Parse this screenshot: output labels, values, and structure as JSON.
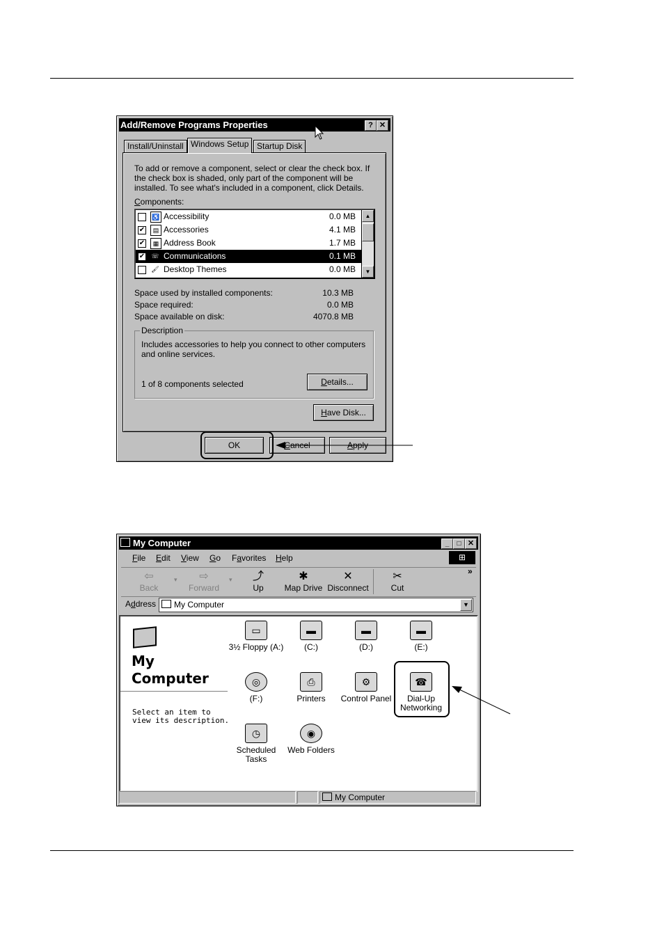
{
  "dialog": {
    "title": "Add/Remove Programs Properties",
    "title_help": "?",
    "title_close": "✕",
    "tabs": [
      {
        "label": "Install/Uninstall"
      },
      {
        "label": "Windows Setup"
      },
      {
        "label": "Startup Disk"
      }
    ],
    "instructions": [
      "To add or remove a component, select or clear the check box. If",
      "the check box is shaded, only part of the component will be",
      "installed. To see what's included in a component, click Details."
    ],
    "components_label_first": "C",
    "components_label_rest": "omponents:",
    "components": [
      {
        "name": "Accessibility",
        "size": "0.0 MB",
        "checked": false,
        "icon": "accessibility-icon"
      },
      {
        "name": "Accessories",
        "size": "4.1 MB",
        "checked": true,
        "icon": "accessories-icon"
      },
      {
        "name": "Address Book",
        "size": "1.7 MB",
        "checked": true,
        "icon": "address-book-icon"
      },
      {
        "name": "Communications",
        "size": "0.1 MB",
        "checked": true,
        "icon": "communications-icon",
        "selected": true
      },
      {
        "name": "Desktop Themes",
        "size": "0.0 MB",
        "checked": false,
        "icon": "desktop-themes-icon"
      }
    ],
    "space": [
      {
        "label": "Space used by installed components:",
        "value": "10.3 MB"
      },
      {
        "label": "Space required:",
        "value": "0.0 MB"
      },
      {
        "label": "Space available on disk:",
        "value": "4070.8 MB"
      }
    ],
    "description_label": "Description",
    "description_lines": [
      "Includes accessories to help you connect to other computers",
      "and online services."
    ],
    "selected_count": "1 of 8 components selected",
    "details_first": "D",
    "details_rest": "etails...",
    "havedisk_first": "H",
    "havedisk_rest": "ave Disk...",
    "ok_label": "OK",
    "cancel_first": "C",
    "cancel_rest": "ancel",
    "apply_first": "A",
    "apply_rest": "pply"
  },
  "explorer": {
    "title": "My Computer",
    "menu": [
      {
        "first": "F",
        "rest": "ile"
      },
      {
        "first": "E",
        "rest": "dit"
      },
      {
        "first": "V",
        "rest": "iew"
      },
      {
        "first": "G",
        "rest": "o"
      },
      {
        "first": "a",
        "pre": "F",
        "rest": "vorites"
      },
      {
        "first": "H",
        "rest": "elp"
      }
    ],
    "toolbar": [
      {
        "label": "Back",
        "icon": "back-arrow-icon",
        "glyph": "⇦",
        "disabled": true
      },
      {
        "label": "Forward",
        "icon": "forward-arrow-icon",
        "glyph": "⇨",
        "disabled": true
      },
      {
        "label": "Up",
        "icon": "up-folder-icon",
        "glyph": "⤴",
        "disabled": false
      },
      {
        "label": "Map Drive",
        "icon": "map-drive-icon",
        "glyph": "✱",
        "disabled": false
      },
      {
        "label": "Disconnect",
        "icon": "disconnect-icon",
        "glyph": "✕",
        "disabled": false
      },
      {
        "label": "Cut",
        "icon": "scissors-icon",
        "glyph": "✂",
        "disabled": false
      }
    ],
    "chevron": "»",
    "address_label_pre": "A",
    "address_label_first": "d",
    "address_label_rest": "dress",
    "address_value": "My Computer",
    "side_title_1": "My",
    "side_title_2": "Computer",
    "side_text_1": "Select an item to",
    "side_text_2": "view its description.",
    "items": [
      {
        "label": "3½ Floppy (A:)",
        "icon": "floppy-drive-icon",
        "glyph": "▭"
      },
      {
        "label": "(C:)",
        "icon": "hard-drive-icon",
        "glyph": "▬"
      },
      {
        "label": "(D:)",
        "icon": "hard-drive-icon",
        "glyph": "▬"
      },
      {
        "label": "(E:)",
        "icon": "hard-drive-icon",
        "glyph": "▬"
      },
      {
        "label": "(F:)",
        "icon": "cd-drive-icon",
        "glyph": "◎"
      },
      {
        "label": "Printers",
        "icon": "printers-folder-icon",
        "glyph": "⎙"
      },
      {
        "label": "Control Panel",
        "icon": "control-panel-icon",
        "glyph": "⚙"
      },
      {
        "label": "Dial-Up Networking",
        "label_1": "Dial-Up",
        "label_2": "Networking",
        "icon": "dialup-networking-icon",
        "glyph": "☎"
      },
      {
        "label": "Scheduled Tasks",
        "label_1": "Scheduled",
        "label_2": "Tasks",
        "icon": "scheduled-tasks-icon",
        "glyph": "◷"
      },
      {
        "label": "Web Folders",
        "icon": "web-folders-icon",
        "glyph": "◉"
      }
    ],
    "status_text": "My Computer"
  }
}
